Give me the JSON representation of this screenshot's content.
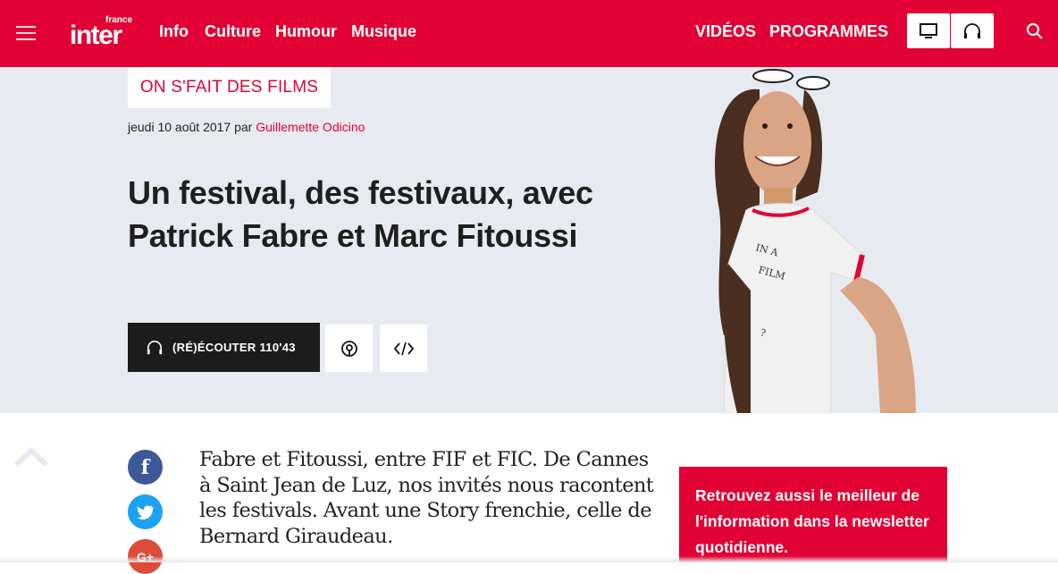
{
  "header": {
    "logo_small": "france",
    "logo_big": "inter",
    "nav": [
      "Info",
      "Culture",
      "Humour",
      "Musique"
    ],
    "right_nav": [
      "VIDÉOS",
      "PROGRAMMES"
    ],
    "brand_color": "#e20134"
  },
  "article": {
    "show_tag": "ON S'FAIT DES FILMS",
    "date": "jeudi 10 août 2017",
    "by": "par",
    "author": "Guillemette Odicino",
    "title": "Un festival, des festivaux, avec Patrick Fabre et Marc Fitoussi",
    "listen_label": "(RÉ)ÉCOUTER 110'43",
    "intro": "Fabre et Fitoussi, entre FIF et FIC. De Cannes à Saint Jean de Luz, nos invités nous racontent les festivals. Avant une Story frenchie, celle de Bernard Giraudeau."
  },
  "social": {
    "facebook": "f",
    "google_plus": "G+"
  },
  "newsletter": {
    "text": "Retrouvez aussi le meilleur de l'information dans la newsletter quotidienne."
  },
  "icons": [
    "menu-icon",
    "tv-icon",
    "headphones-icon",
    "search-icon",
    "podcast-icon",
    "embed-icon",
    "chevron-up-icon",
    "facebook-icon",
    "twitter-icon",
    "google-plus-icon"
  ]
}
